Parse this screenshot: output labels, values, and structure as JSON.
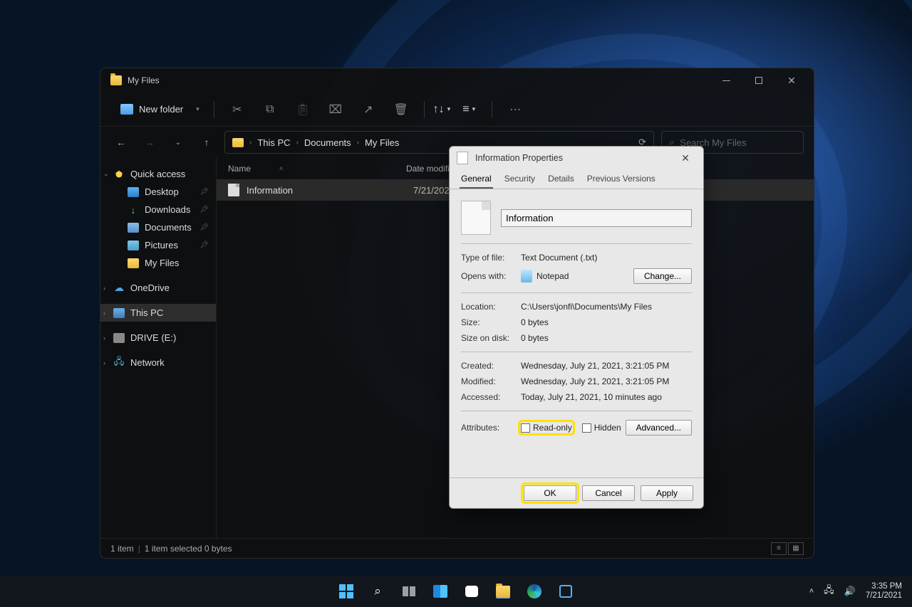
{
  "explorer": {
    "title": "My Files",
    "toolbar": {
      "new_label": "New folder"
    },
    "breadcrumb": [
      "This PC",
      "Documents",
      "My Files"
    ],
    "search_placeholder": "Search My Files",
    "columns": {
      "name": "Name",
      "date": "Date modified"
    },
    "file": {
      "name": "Information",
      "date": "7/21/2021"
    },
    "sidebar": {
      "quick_access": "Quick access",
      "desktop": "Desktop",
      "downloads": "Downloads",
      "documents": "Documents",
      "pictures": "Pictures",
      "my_files": "My Files",
      "onedrive": "OneDrive",
      "this_pc": "This PC",
      "drive": "DRIVE (E:)",
      "network": "Network"
    },
    "status": {
      "items": "1 item",
      "selected": "1 item selected  0 bytes"
    }
  },
  "props": {
    "title": "Information Properties",
    "tabs": {
      "general": "General",
      "security": "Security",
      "details": "Details",
      "prev": "Previous Versions"
    },
    "filename": "Information",
    "type_label": "Type of file:",
    "type_val": "Text Document (.txt)",
    "opens_label": "Opens with:",
    "opens_val": "Notepad",
    "change": "Change...",
    "location_label": "Location:",
    "location_val": "C:\\Users\\jonfi\\Documents\\My Files",
    "size_label": "Size:",
    "size_val": "0 bytes",
    "disk_label": "Size on disk:",
    "disk_val": "0 bytes",
    "created_label": "Created:",
    "created_val": "Wednesday, July 21, 2021, 3:21:05 PM",
    "modified_label": "Modified:",
    "modified_val": "Wednesday, July 21, 2021, 3:21:05 PM",
    "accessed_label": "Accessed:",
    "accessed_val": "Today, July 21, 2021, 10 minutes ago",
    "attrs_label": "Attributes:",
    "readonly": "Read-only",
    "hidden": "Hidden",
    "advanced": "Advanced...",
    "ok": "OK",
    "cancel": "Cancel",
    "apply": "Apply"
  },
  "taskbar": {
    "time": "3:35 PM",
    "date": "7/21/2021"
  }
}
